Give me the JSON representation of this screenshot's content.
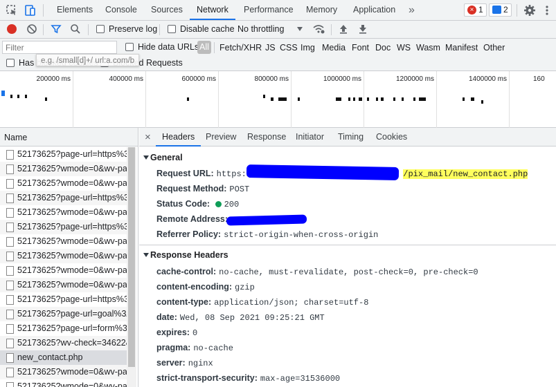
{
  "devtools": {
    "tabs": [
      "Elements",
      "Console",
      "Sources",
      "Network",
      "Performance",
      "Memory",
      "Application"
    ],
    "active_tab": "Network",
    "more_label": "»",
    "error_count": "1",
    "message_count": "2"
  },
  "toolbar": {
    "preserve_log": "Preserve log",
    "disable_cache": "Disable cache",
    "throttling": "No throttling"
  },
  "filter": {
    "placeholder": "Filter",
    "hide_data_urls": "Hide data URLs",
    "types": [
      "All",
      "Fetch/XHR",
      "JS",
      "CSS",
      "Img",
      "Media",
      "Font",
      "Doc",
      "WS",
      "Wasm",
      "Manifest",
      "Other"
    ],
    "has_blocked_cookies": "Has blocked cookies",
    "blocked_requests": "Blocked Requests",
    "tooltip": "e.g. /small[d]+/ url:a.com/b"
  },
  "overview": {
    "ticks": [
      "200000 ms",
      "400000 ms",
      "600000 ms",
      "800000 ms",
      "1000000 ms",
      "1200000 ms",
      "1400000 ms",
      "160"
    ]
  },
  "requests": {
    "header": "Name",
    "items": [
      "52173625?page-url=https%3.",
      "52173625?wmode=0&wv-par",
      "52173625?wmode=0&wv-par",
      "52173625?page-url=https%3.",
      "52173625?wmode=0&wv-par",
      "52173625?page-url=https%3.",
      "52173625?wmode=0&wv-par",
      "52173625?wmode=0&wv-par",
      "52173625?wmode=0&wv-par",
      "52173625?wmode=0&wv-par",
      "52173625?page-url=https%3.",
      "52173625?page-url=goal%3A",
      "52173625?page-url=form%3A",
      "52173625?wv-check=34622&",
      "new_contact.php",
      "52173625?wmode=0&wv-par",
      "52173625?wmode=0&wv-par"
    ],
    "selected": "new_contact.php"
  },
  "details": {
    "close": "×",
    "tabs": [
      "Headers",
      "Preview",
      "Response",
      "Initiator",
      "Timing",
      "Cookies"
    ],
    "active_tab": "Headers",
    "general_title": "General",
    "general": {
      "request_url_key": "Request URL:",
      "request_url_prefix": "https://",
      "request_url_suffix": "/pix_mail/new_contact.php",
      "method_key": "Request Method:",
      "method": "POST",
      "status_key": "Status Code:",
      "status": "200",
      "remote_key": "Remote Address:",
      "policy_key": "Referrer Policy:",
      "policy": "strict-origin-when-cross-origin"
    },
    "response_title": "Response Headers",
    "response": [
      {
        "k": "cache-control:",
        "v": "no-cache, must-revalidate, post-check=0, pre-check=0"
      },
      {
        "k": "content-encoding:",
        "v": "gzip"
      },
      {
        "k": "content-type:",
        "v": "application/json; charset=utf-8"
      },
      {
        "k": "date:",
        "v": "Wed, 08 Sep 2021 09:25:21 GMT"
      },
      {
        "k": "expires:",
        "v": "0"
      },
      {
        "k": "pragma:",
        "v": "no-cache"
      },
      {
        "k": "server:",
        "v": "nginx"
      },
      {
        "k": "strict-transport-security:",
        "v": "max-age=31536000"
      }
    ]
  },
  "colors": {
    "accent": "#1a73e8",
    "record": "#d93025",
    "redaction": "#0000ff",
    "highlight": "#ffff5e",
    "status_ok": "#0f9d58"
  }
}
